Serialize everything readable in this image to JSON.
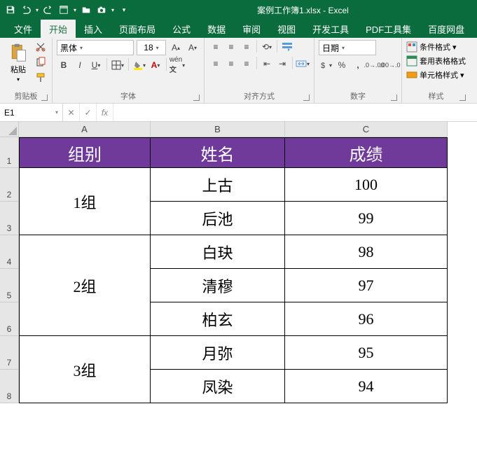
{
  "app": {
    "title": "案例工作簿1.xlsx - Excel"
  },
  "qat": [
    "save",
    "undo",
    "redo",
    "new",
    "open",
    "camera",
    "more"
  ],
  "tabs": {
    "file": "文件",
    "items": [
      "开始",
      "插入",
      "页面布局",
      "公式",
      "数据",
      "审阅",
      "视图",
      "开发工具",
      "PDF工具集",
      "百度网盘"
    ],
    "active": 0
  },
  "ribbon": {
    "clipboard": {
      "title": "剪贴板",
      "paste": "粘贴"
    },
    "font": {
      "title": "字体",
      "name": "黑体",
      "size": "18"
    },
    "align": {
      "title": "对齐方式"
    },
    "number": {
      "title": "数字",
      "format": "日期"
    },
    "styles": {
      "title": "样式",
      "cond": "条件格式",
      "tfmt": "套用表格格式",
      "cfmt": "单元格样式"
    }
  },
  "formulabar": {
    "cell": "E1",
    "value": ""
  },
  "columns": [
    "A",
    "B",
    "C"
  ],
  "rowheads": [
    "1",
    "2",
    "3",
    "4",
    "5",
    "6",
    "7",
    "8"
  ],
  "header": {
    "a": "组别",
    "b": "姓名",
    "c": "成绩"
  },
  "data": [
    {
      "group": "1组",
      "span": 2,
      "rows": [
        {
          "name": "上古",
          "score": "100"
        },
        {
          "name": "后池",
          "score": "99"
        }
      ]
    },
    {
      "group": "2组",
      "span": 3,
      "rows": [
        {
          "name": "白玦",
          "score": "98"
        },
        {
          "name": "清穆",
          "score": "97"
        },
        {
          "name": "柏玄",
          "score": "96"
        }
      ]
    },
    {
      "group": "3组",
      "span": 2,
      "rows": [
        {
          "name": "月弥",
          "score": "95"
        },
        {
          "name": "凤染",
          "score": "94"
        }
      ]
    }
  ]
}
